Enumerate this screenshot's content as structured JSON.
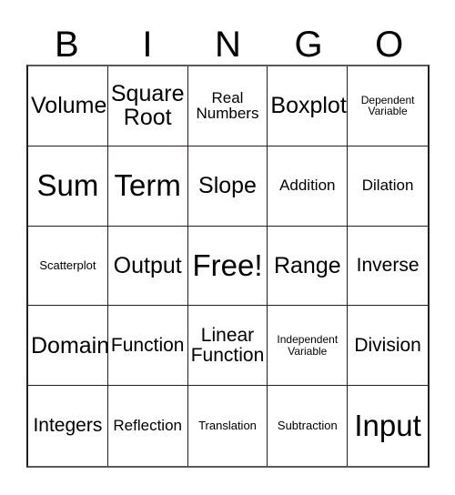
{
  "card": {
    "header_letters": [
      "B",
      "I",
      "N",
      "G",
      "O"
    ],
    "free_space_label": "Free!",
    "rows": [
      [
        {
          "label": "Volume",
          "size": "lg"
        },
        {
          "label": "Square\nRoot",
          "size": "lg"
        },
        {
          "label": "Real\nNumbers",
          "size": "sm"
        },
        {
          "label": "Boxplot",
          "size": "lg"
        },
        {
          "label": "Dependent\nVariable",
          "size": "xxs"
        }
      ],
      [
        {
          "label": "Sum",
          "size": "xl"
        },
        {
          "label": "Term",
          "size": "xl"
        },
        {
          "label": "Slope",
          "size": "lg"
        },
        {
          "label": "Addition",
          "size": "sm"
        },
        {
          "label": "Dilation",
          "size": "sm"
        }
      ],
      [
        {
          "label": "Scatterplot",
          "size": "xs"
        },
        {
          "label": "Output",
          "size": "lg"
        },
        {
          "label": "Free!",
          "size": "xl"
        },
        {
          "label": "Range",
          "size": "lg"
        },
        {
          "label": "Inverse",
          "size": "md"
        }
      ],
      [
        {
          "label": "Domain",
          "size": "lg"
        },
        {
          "label": "Function",
          "size": "md"
        },
        {
          "label": "Linear\nFunction",
          "size": "md"
        },
        {
          "label": "Independent\nVariable",
          "size": "xxs"
        },
        {
          "label": "Division",
          "size": "md"
        }
      ],
      [
        {
          "label": "Integers",
          "size": "md"
        },
        {
          "label": "Reflection",
          "size": "sm"
        },
        {
          "label": "Translation",
          "size": "xs"
        },
        {
          "label": "Subtraction",
          "size": "xs"
        },
        {
          "label": "Input",
          "size": "xl"
        }
      ]
    ]
  },
  "colors": {
    "background": "#ffffff",
    "text": "#000000",
    "grid_line": "#231f20",
    "grid_outer_line": "#58595b"
  }
}
